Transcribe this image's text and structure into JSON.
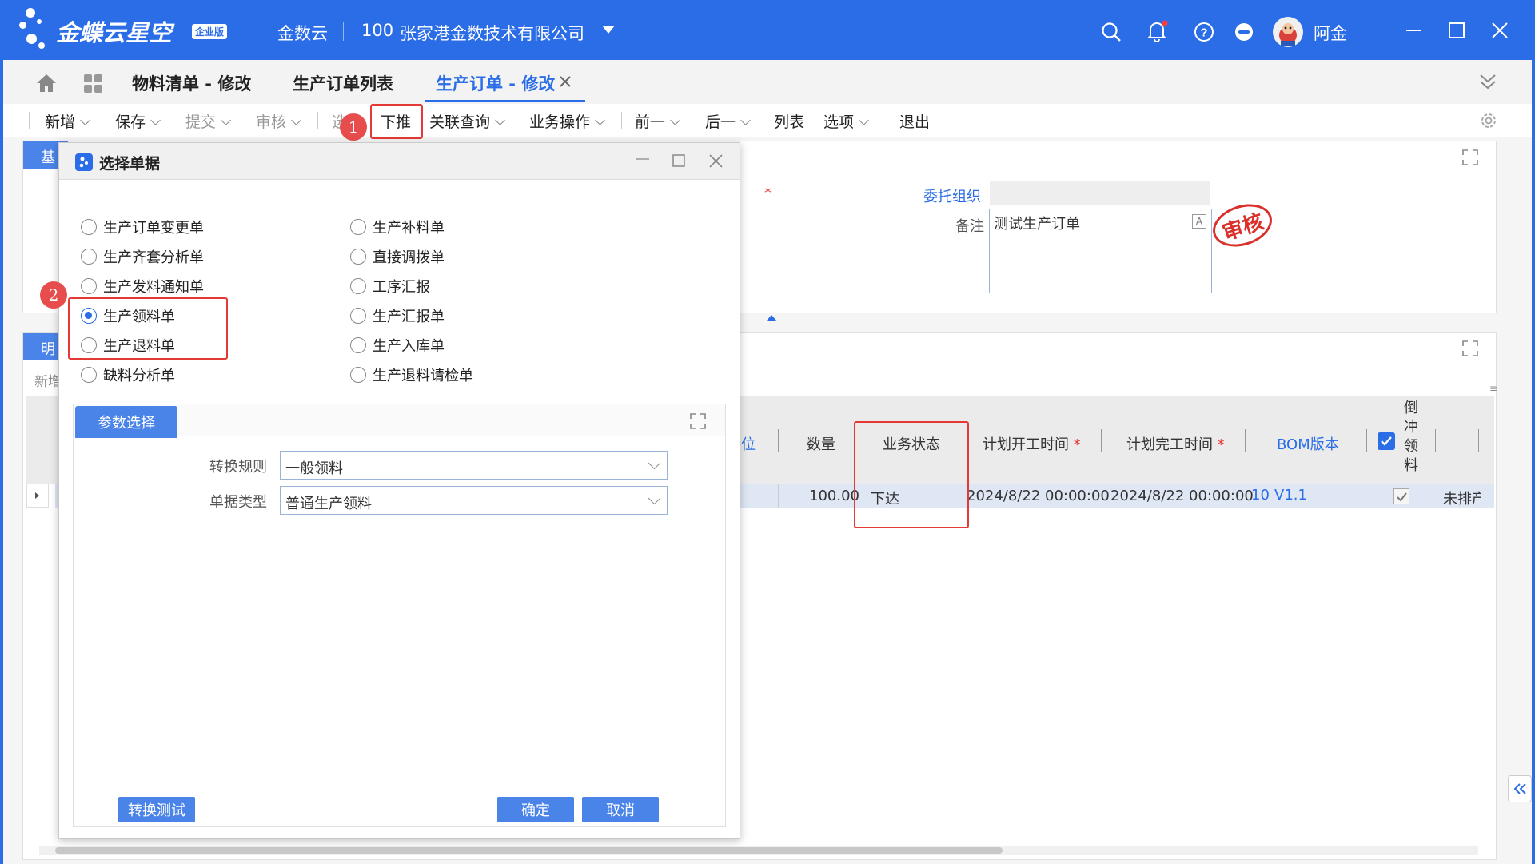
{
  "app": {
    "brand": "金蝶云星空",
    "edition": "企业版",
    "cloud": "金数云",
    "org_code": "100",
    "org_name": "张家港金数技术有限公司",
    "user": "阿金"
  },
  "tabs": [
    {
      "label": "物料清单 - 修改"
    },
    {
      "label": "生产订单列表"
    },
    {
      "label": "生产订单 - 修改"
    }
  ],
  "toolbar": {
    "new": "新增",
    "save": "保存",
    "submit": "提交",
    "audit": "审核",
    "select": "选单",
    "push": "下推",
    "related": "关联查询",
    "business": "业务操作",
    "prev": "前一",
    "next": "后一",
    "list": "列表",
    "options": "选项",
    "exit": "退出"
  },
  "header_form": {
    "base_tab": "基",
    "entrust_org_label": "委托组织",
    "note_label": "备注",
    "note_value": "测试生产订单",
    "stamp": "审核"
  },
  "detail": {
    "tab": "明",
    "new_row": "新增",
    "columns": [
      "位",
      "数量",
      "业务状态",
      "计划开工时间",
      "计划完工时间",
      "BOM版本",
      "倒冲领料"
    ],
    "row": {
      "qty": "100.00",
      "status": "下达",
      "plan_start": "2024/8/22 00:00:00",
      "plan_end": "2024/8/22 00:00:00",
      "bom_no": "10",
      "bom_ver": "V1.1",
      "schedule": "未排产"
    }
  },
  "annotations": {
    "b1": "1",
    "b2": "2"
  },
  "dialog": {
    "title": "选择单据",
    "left_options": [
      "生产订单变更单",
      "生产齐套分析单",
      "生产发料通知单",
      "生产领料单",
      "生产退料单",
      "缺料分析单"
    ],
    "right_options": [
      "生产补料单",
      "直接调拨单",
      "工序汇报",
      "生产汇报单",
      "生产入库单",
      "生产退料请检单"
    ],
    "selected": "生产领料单",
    "param_tab": "参数选择",
    "rule_label": "转换规则",
    "rule_value": "一般领料",
    "type_label": "单据类型",
    "type_value": "普通生产领料",
    "test_btn": "转换测试",
    "ok_btn": "确定",
    "cancel_btn": "取消"
  },
  "colors": {
    "brand_blue": "#2a6de6",
    "annotation_red": "#e53935"
  }
}
